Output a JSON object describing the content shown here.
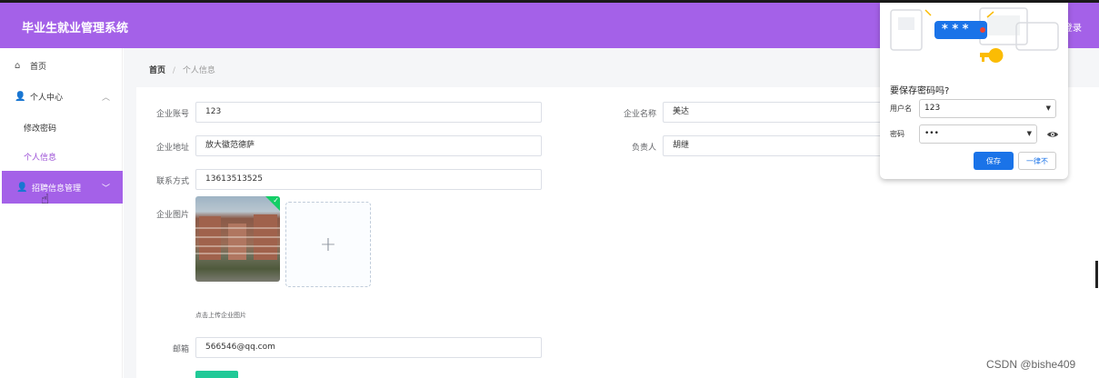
{
  "header": {
    "title": "毕业生就业管理系统",
    "logout_label": "登录"
  },
  "sidebar": {
    "items": [
      {
        "label": "首页",
        "icon": "home-icon"
      },
      {
        "label": "个人中心",
        "icon": "user-icon"
      },
      {
        "label": "修改密码"
      },
      {
        "label": "个人信息"
      },
      {
        "label": "招聘信息管理",
        "icon": "user-icon"
      }
    ]
  },
  "breadcrumb": {
    "home": "首页",
    "separator": "/",
    "current": "个人信息"
  },
  "form": {
    "account_label": "企业账号",
    "account_value": "123",
    "name_label": "企业名称",
    "name_value": "美达",
    "address_label": "企业地址",
    "address_value": "放大徽范德萨",
    "manager_label": "负责人",
    "manager_value": "胡继",
    "contact_label": "联系方式",
    "contact_value": "13613513525",
    "image_label": "企业图片",
    "upload_plus": "+",
    "upload_hint": "点击上传企业图片",
    "email_label": "邮箱",
    "email_value": "566546@qq.com"
  },
  "password_popup": {
    "title": "要保存密码吗?",
    "username_label": "用户名",
    "username_value": "123",
    "password_label": "密码",
    "password_value": "•••",
    "art_password": "* * *",
    "save_label": "保存",
    "never_label": "一律不"
  },
  "watermark": "CSDN @bishe409",
  "colors": {
    "header": "#a461e8",
    "accent": "#9b4fd6",
    "save_button": "#1a73e8",
    "success": "#13ce66"
  }
}
